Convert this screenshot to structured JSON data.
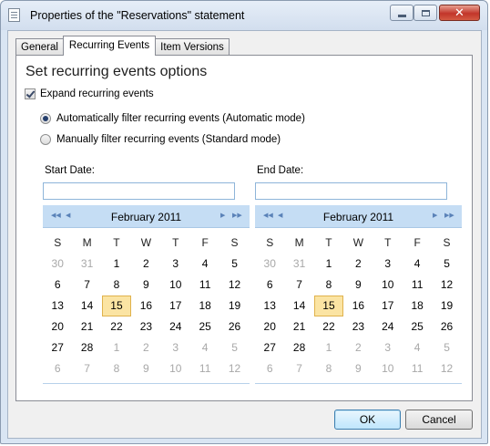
{
  "window": {
    "title": "Properties of the \"Reservations\" statement",
    "close_glyph": "✕"
  },
  "tabs": [
    {
      "label": "General",
      "active": false
    },
    {
      "label": "Recurring Events",
      "active": true
    },
    {
      "label": "Item Versions",
      "active": false
    }
  ],
  "panel": {
    "heading": "Set recurring events options",
    "expand_checkbox": {
      "label": "Expand recurring events",
      "checked": true
    },
    "radios": [
      {
        "label": "Automatically filter recurring events (Automatic mode)",
        "selected": true
      },
      {
        "label": "Manually filter recurring events (Standard mode)",
        "selected": false
      }
    ],
    "start_date": {
      "label": "Start Date:",
      "value": ""
    },
    "end_date": {
      "label": "End Date:",
      "value": ""
    }
  },
  "calendar": {
    "month": "February 2011",
    "nav_first": "◀◀",
    "nav_prev": "◀",
    "nav_next": "▶",
    "nav_last": "▶▶",
    "weekdays": [
      "S",
      "M",
      "T",
      "W",
      "T",
      "F",
      "S"
    ],
    "weeks": [
      [
        "30",
        "31",
        "1",
        "2",
        "3",
        "4",
        "5"
      ],
      [
        "6",
        "7",
        "8",
        "9",
        "10",
        "11",
        "12"
      ],
      [
        "13",
        "14",
        "15",
        "16",
        "17",
        "18",
        "19"
      ],
      [
        "20",
        "21",
        "22",
        "23",
        "24",
        "25",
        "26"
      ],
      [
        "27",
        "28",
        "1",
        "2",
        "3",
        "4",
        "5"
      ],
      [
        "6",
        "7",
        "8",
        "9",
        "10",
        "11",
        "12"
      ]
    ],
    "today": "15"
  },
  "buttons": {
    "ok": "OK",
    "cancel": "Cancel"
  },
  "colors": {
    "calendar_header": "#c5ddf4",
    "today_highlight": "#fbe4a3",
    "close_button": "#c2352a"
  }
}
